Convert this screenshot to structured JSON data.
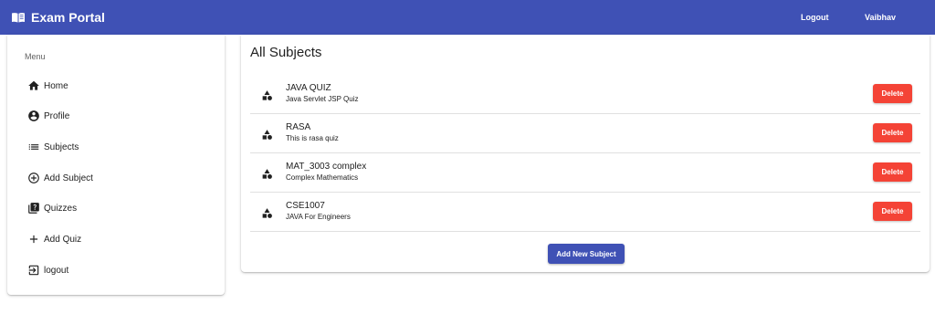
{
  "header": {
    "brand_icon": "menu-book-icon",
    "title": "Exam Portal",
    "logout_label": "Logout",
    "user_label": "Vaibhav",
    "background": "#3f51b5"
  },
  "sidebar": {
    "menu_title": "Menu",
    "items": [
      {
        "label": "Home",
        "icon": "home-icon"
      },
      {
        "label": "Profile",
        "icon": "account-circle-icon"
      },
      {
        "label": "Subjects",
        "icon": "list-icon"
      },
      {
        "label": "Add Subject",
        "icon": "add-circle-outline-icon"
      },
      {
        "label": "Quizzes",
        "icon": "quiz-icon"
      },
      {
        "label": "Add Quiz",
        "icon": "add-icon"
      },
      {
        "label": "logout",
        "icon": "logout-icon"
      }
    ]
  },
  "main": {
    "title": "All Subjects",
    "subjects": [
      {
        "title": "JAVA QUIZ",
        "description": "Java Servlet JSP Quiz",
        "icon": "category-icon",
        "delete_label": "Delete"
      },
      {
        "title": "RASA",
        "description": "This is rasa quiz",
        "icon": "category-icon",
        "delete_label": "Delete"
      },
      {
        "title": "MAT_3003 complex",
        "description": "Complex Mathematics",
        "icon": "category-icon",
        "delete_label": "Delete"
      },
      {
        "title": "CSE1007",
        "description": "JAVA For Engineers",
        "icon": "category-icon",
        "delete_label": "Delete"
      }
    ],
    "add_button_label": "Add New Subject"
  },
  "colors": {
    "primary": "#3f51b5",
    "warn": "#f44336"
  }
}
